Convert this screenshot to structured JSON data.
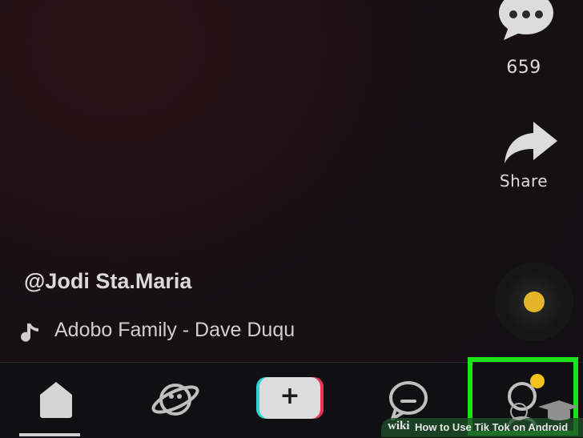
{
  "video": {
    "creator": "@Jodi Sta.Maria",
    "song": "Adobo Family - Dave Duqu"
  },
  "actions": {
    "comment_count": "659",
    "share_label": "Share"
  },
  "navbar": {
    "items": [
      {
        "name": "home",
        "icon": "home-icon"
      },
      {
        "name": "discover",
        "icon": "planet-icon"
      },
      {
        "name": "create",
        "label": "+"
      },
      {
        "name": "inbox",
        "icon": "chat-bubble-icon"
      },
      {
        "name": "me",
        "icon": "profile-icon"
      }
    ]
  },
  "watermark": {
    "brand": "wiki",
    "text": "How to Use Tik Tok on Android"
  },
  "colors": {
    "highlight": "#19e619",
    "notification": "#f4c21c",
    "create_cyan": "#2dd5d0",
    "create_red": "#ec2f52"
  }
}
